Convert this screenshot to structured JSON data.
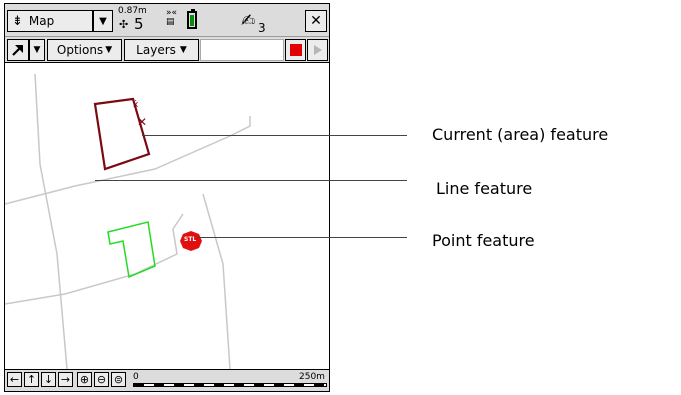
{
  "topbar": {
    "app_title": "Map",
    "app_icon": "compass-north-icon",
    "dropdown_icon": "chevron-down-icon",
    "gps_accuracy": "0.87m",
    "satellite_count": "5",
    "satellite_icon": "satellite-icon",
    "receiver_icon": "gps-receiver-icon",
    "battery_icon": "battery-icon",
    "pen_icon": "pen-icon",
    "pen_count": "3",
    "close_icon": "close-icon"
  },
  "toolbar": {
    "select_tool_icon": "select-arrow-icon",
    "options_label": "Options",
    "layers_label": "Layers",
    "stop_icon": "stop-square-icon",
    "play_icon": "play-triangle-icon",
    "stop_color": "#e30000"
  },
  "bottombar": {
    "nav_left": "←",
    "nav_up": "↑",
    "nav_down": "↓",
    "nav_right": "→",
    "zoom_in_icon": "zoom-in-icon",
    "zoom_out_icon": "zoom-out-icon",
    "zoom_extents_icon": "zoom-extents-icon",
    "scale_start": "0",
    "scale_end": "250m"
  },
  "map": {
    "area_feature_color": "#7a0a12",
    "selected_area_color": "#22dd22",
    "point_feature_color": "#e01010",
    "point_feature_label": "STL",
    "line_color": "#c8c8c8"
  },
  "callouts": {
    "current_area": "Current (area) feature",
    "line_feature": "Line feature",
    "point_feature": "Point feature"
  }
}
